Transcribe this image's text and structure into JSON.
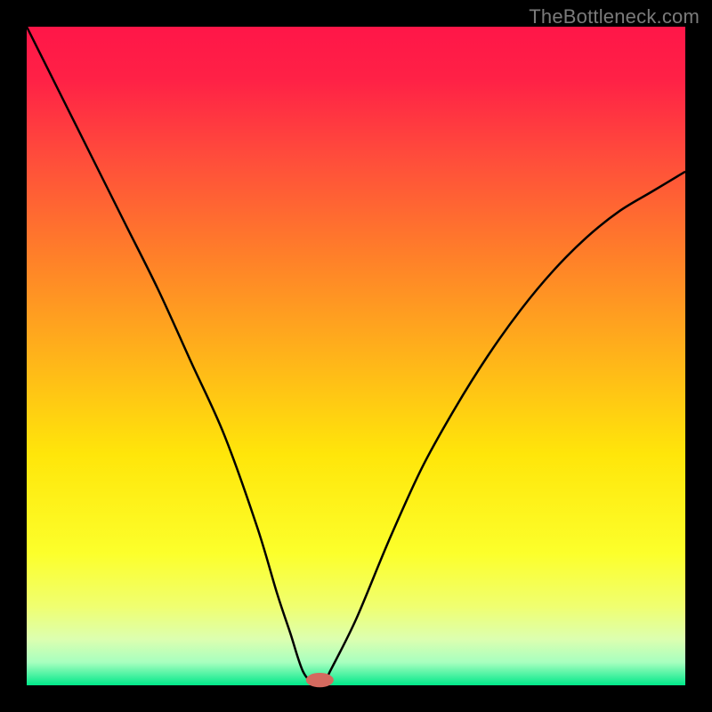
{
  "watermark": "TheBottleneck.com",
  "chart_data": {
    "type": "line",
    "title": "",
    "xlabel": "",
    "ylabel": "",
    "xlim": [
      0,
      100
    ],
    "ylim": [
      0,
      100
    ],
    "axes_visible": false,
    "background_gradient_stops": [
      {
        "pos": 0.0,
        "color": "#ff1648"
      },
      {
        "pos": 0.08,
        "color": "#ff2146"
      },
      {
        "pos": 0.2,
        "color": "#ff4d3b"
      },
      {
        "pos": 0.35,
        "color": "#ff8029"
      },
      {
        "pos": 0.5,
        "color": "#ffb31a"
      },
      {
        "pos": 0.65,
        "color": "#ffe60a"
      },
      {
        "pos": 0.8,
        "color": "#fcff2b"
      },
      {
        "pos": 0.88,
        "color": "#f0ff70"
      },
      {
        "pos": 0.93,
        "color": "#dcffb0"
      },
      {
        "pos": 0.965,
        "color": "#a8ffbf"
      },
      {
        "pos": 1.0,
        "color": "#00e88a"
      }
    ],
    "series": [
      {
        "name": "bottleneck-curve",
        "color": "#000000",
        "stroke_width": 2.5,
        "x": [
          0,
          5,
          10,
          15,
          20,
          25,
          30,
          35,
          38,
          40,
          42,
          44,
          45,
          46,
          50,
          55,
          60,
          65,
          70,
          75,
          80,
          85,
          90,
          95,
          100
        ],
        "values": [
          100,
          90,
          80,
          70,
          60,
          49,
          38,
          24,
          14,
          8,
          2,
          0,
          0,
          2,
          10,
          22,
          33,
          42,
          50,
          57,
          63,
          68,
          72,
          75,
          78
        ]
      }
    ],
    "markers": [
      {
        "name": "optimal-marker",
        "x": 44.5,
        "y": 0.8,
        "rx": 2.1,
        "ry": 1.1,
        "fill": "#d46a5f"
      }
    ]
  }
}
